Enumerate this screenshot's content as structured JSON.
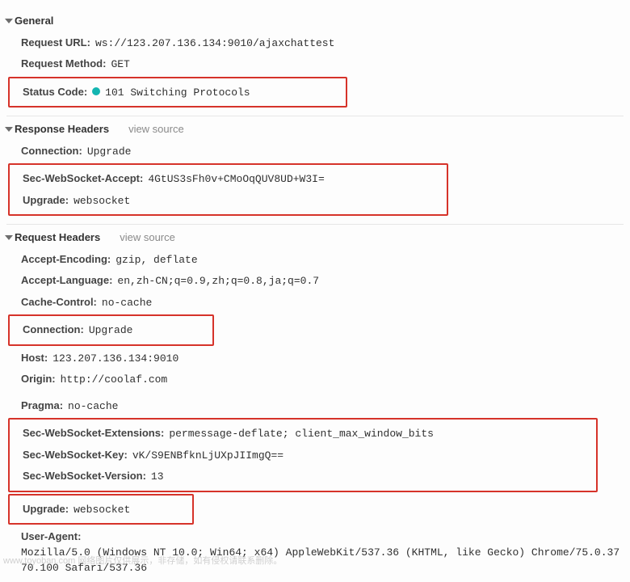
{
  "sections": {
    "general": {
      "title": "General",
      "request_url": {
        "label": "Request URL:",
        "value": "ws://123.207.136.134:9010/ajaxchattest"
      },
      "request_method": {
        "label": "Request Method:",
        "value": "GET"
      },
      "status_code": {
        "label": "Status Code:",
        "value": "101 Switching Protocols"
      }
    },
    "response": {
      "title": "Response Headers",
      "view_source": "view source",
      "connection": {
        "label": "Connection:",
        "value": "Upgrade"
      },
      "sec_ws_accept": {
        "label": "Sec-WebSocket-Accept:",
        "value": "4GtUS3sFh0v+CMoOqQUV8UD+W3I="
      },
      "upgrade": {
        "label": "Upgrade:",
        "value": "websocket"
      }
    },
    "request": {
      "title": "Request Headers",
      "view_source": "view source",
      "accept_encoding": {
        "label": "Accept-Encoding:",
        "value": "gzip, deflate"
      },
      "accept_language": {
        "label": "Accept-Language:",
        "value": "en,zh-CN;q=0.9,zh;q=0.8,ja;q=0.7"
      },
      "cache_control": {
        "label": "Cache-Control:",
        "value": "no-cache"
      },
      "connection": {
        "label": "Connection:",
        "value": "Upgrade"
      },
      "host": {
        "label": "Host:",
        "value": "123.207.136.134:9010"
      },
      "origin": {
        "label": "Origin:",
        "value": "http://coolaf.com"
      },
      "pragma": {
        "label": "Pragma:",
        "value": "no-cache"
      },
      "sec_ws_ext": {
        "label": "Sec-WebSocket-Extensions:",
        "value": "permessage-deflate; client_max_window_bits"
      },
      "sec_ws_key": {
        "label": "Sec-WebSocket-Key:",
        "value": "vK/S9ENBfknLjUXpJIImgQ=="
      },
      "sec_ws_ver": {
        "label": "Sec-WebSocket-Version:",
        "value": "13"
      },
      "upgrade": {
        "label": "Upgrade:",
        "value": "websocket"
      },
      "user_agent": {
        "label": "User-Agent:",
        "value": "Mozilla/5.0 (Windows NT 10.0; Win64; x64) AppleWebKit/537.36 (KHTML, like Gecko) Chrome/75.0.3770.100 Safari/537.36"
      }
    }
  },
  "watermark": "www.toyoban.com  网络图片仅供展示，非存储，如有侵权请联系删除。"
}
